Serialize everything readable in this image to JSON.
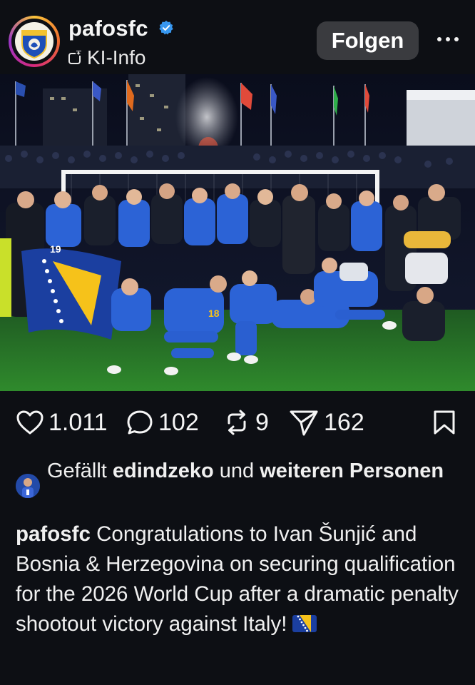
{
  "header": {
    "username": "pafosfc",
    "ai_label": "KI-Info",
    "follow_label": "Folgen",
    "verified_icon": "verified-badge-icon",
    "more_icon": "more-options-icon"
  },
  "post": {
    "image_icon": "team-celebration-photo"
  },
  "actions": {
    "likes": "1.011",
    "comments": "102",
    "reposts": "9",
    "shares": "162"
  },
  "likes_line": {
    "prefix": "Gefällt",
    "user": "edindzeko",
    "middle": "und",
    "rest": "weiteren Personen"
  },
  "caption": {
    "user": "pafosfc",
    "text": "Congratulations to Ivan Šunjić and Bosnia & Herzegovina on securing qualification for the 2026 World Cup after a dramatic penalty shootout victory against Italy!"
  },
  "colors": {
    "background": "#0d0f14",
    "follow_button": "#3a3b3f",
    "verified_blue": "#3797f0",
    "bosnia_blue": "#1b3fa0",
    "bosnia_yellow": "#f6c21a"
  }
}
